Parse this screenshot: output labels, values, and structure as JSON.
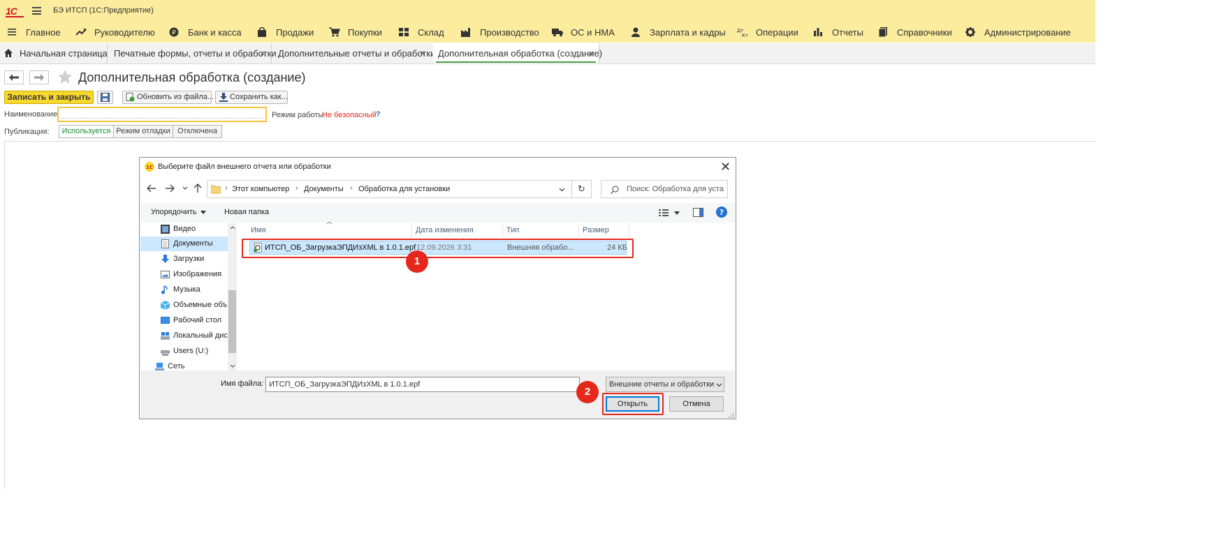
{
  "app": {
    "title": "БЭ ИТСП  (1С:Предприятие)",
    "logo": "1С"
  },
  "sections": [
    {
      "label": "Главное",
      "icon": "menu-icon"
    },
    {
      "label": "Руководителю",
      "icon": "trend-icon"
    },
    {
      "label": "Банк и касса",
      "icon": "coin-icon"
    },
    {
      "label": "Продажи",
      "icon": "bag-icon"
    },
    {
      "label": "Покупки",
      "icon": "cart-icon"
    },
    {
      "label": "Склад",
      "icon": "grid-icon"
    },
    {
      "label": "Производство",
      "icon": "factory-icon"
    },
    {
      "label": "ОС и НМА",
      "icon": "truck-icon"
    },
    {
      "label": "Зарплата и кадры",
      "icon": "person-icon"
    },
    {
      "label": "Операции",
      "icon": "dt-kt-icon"
    },
    {
      "label": "Отчеты",
      "icon": "bar-chart-icon"
    },
    {
      "label": "Справочники",
      "icon": "book-icon"
    },
    {
      "label": "Администрирование",
      "icon": "gear-icon"
    }
  ],
  "tabs": [
    {
      "label": "Начальная страница"
    },
    {
      "label": "Печатные формы, отчеты и обработки",
      "close": "×"
    },
    {
      "label": "Дополнительные отчеты и обработки",
      "close": "×"
    },
    {
      "label": "Дополнительная обработка (создание)",
      "close": "×"
    }
  ],
  "form": {
    "title": "Дополнительная обработка (создание)",
    "save_close": "Записать и закрыть",
    "update_from_file": "Обновить из файла...",
    "save_as": "Сохранить как...",
    "name_label": "Наименование:",
    "name_value": "",
    "mode_label": "Режим работы:",
    "mode_value": "Не безопасный",
    "help": "?",
    "publication_label": "Публикация:",
    "publication_options": [
      "Используется",
      "Режим отладки",
      "Отключена"
    ],
    "publication_selected": "Используется",
    "mode_color": "#e5281b"
  },
  "dialog": {
    "title": "Выберите файл внешнего отчета или обработки",
    "breadcrumb": [
      "Этот компьютер",
      "Документы",
      "Обработка для установки"
    ],
    "search_placeholder": "Поиск: Обработка для уста...",
    "toolbar": {
      "organize": "Упорядочить",
      "new_folder": "Новая папка"
    },
    "nav": [
      {
        "label": "Видео",
        "icon": "video-icon"
      },
      {
        "label": "Документы",
        "icon": "documents-icon",
        "selected": true
      },
      {
        "label": "Загрузки",
        "icon": "download-icon"
      },
      {
        "label": "Изображения",
        "icon": "images-icon"
      },
      {
        "label": "Музыка",
        "icon": "music-icon"
      },
      {
        "label": "Объемные объ",
        "icon": "3d-objects-icon"
      },
      {
        "label": "Рабочий стол",
        "icon": "desktop-icon"
      },
      {
        "label": "Локальный дис",
        "icon": "local-disk-icon"
      },
      {
        "label": "Users (U:)",
        "icon": "network-drive-icon"
      },
      {
        "label": "Сеть",
        "icon": "network-icon"
      }
    ],
    "columns": [
      "Имя",
      "Дата изменения",
      "Тип",
      "Размер"
    ],
    "files": [
      {
        "name": "ИТСП_ОБ_ЗагрузкаЭПДИзXML в 1.0.1.epf",
        "date": "12.09.2026 3:31",
        "type": "Внешняя обрабо...",
        "size": "24 КБ"
      }
    ],
    "filename_label": "Имя файла:",
    "filename_value": "ИТСП_ОБ_ЗагрузкаЭПДИзXML в 1.0.1.epf",
    "filetype_value": "Внешние отчеты и обработки",
    "open": "Открыть",
    "cancel": "Отмена"
  },
  "annotations": {
    "step1": "1",
    "step2": "2",
    "color": "#e5281b"
  }
}
